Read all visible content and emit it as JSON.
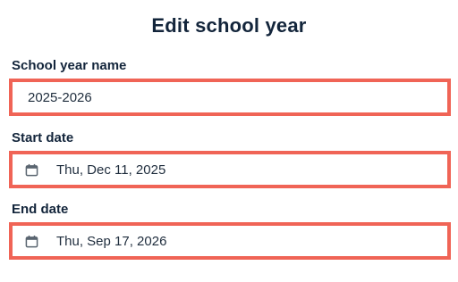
{
  "dialog": {
    "title": "Edit school year"
  },
  "fields": {
    "name": {
      "label": "School year name",
      "value": "2025-2026"
    },
    "start_date": {
      "label": "Start date",
      "value": "Thu, Dec 11, 2025",
      "icon": "calendar-icon"
    },
    "end_date": {
      "label": "End date",
      "value": "Thu, Sep 17, 2026",
      "icon": "calendar-icon"
    }
  },
  "colors": {
    "highlight_border": "#f06456",
    "heading_text": "#13253b"
  }
}
